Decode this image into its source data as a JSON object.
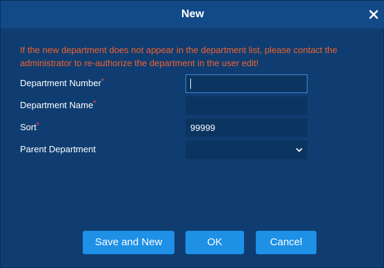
{
  "dialog": {
    "title": "New",
    "close_icon": "close-icon"
  },
  "notice": "If the new department does not appear in the department list, please contact the administrator to re-authorize the department in the user edit!",
  "form": {
    "required_mark": "*",
    "department_number": {
      "label": "Department Number",
      "value": ""
    },
    "department_name": {
      "label": "Department Name",
      "value": ""
    },
    "sort": {
      "label": "Sort",
      "value": "99999"
    },
    "parent_department": {
      "label": "Parent Department",
      "value": "",
      "icon": "chevron-down-icon"
    }
  },
  "buttons": {
    "save_and_new": "Save and New",
    "ok": "OK",
    "cancel": "Cancel"
  },
  "colors": {
    "dialog_bg": "#0f3d71",
    "titlebar_bg": "#124a87",
    "notice_text": "#f2612f",
    "required": "#ff4a4a",
    "button_bg": "#1e90e6",
    "field_bg": "#0b3460",
    "focus_border": "#3d8bd9"
  }
}
